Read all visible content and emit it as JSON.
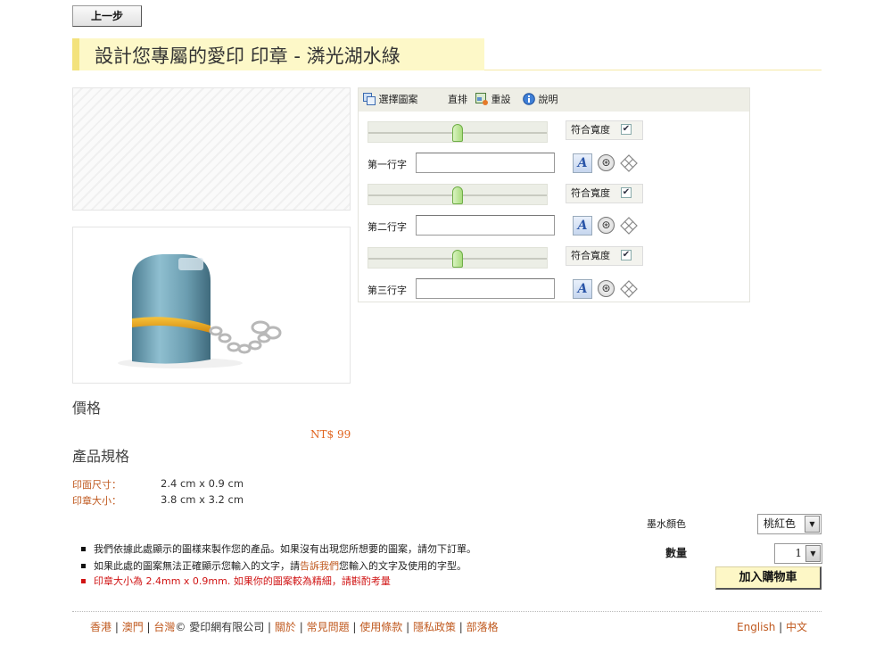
{
  "nav": {
    "back_label": "上一步"
  },
  "title": "設計您專屬的愛印 印章 - 潾光湖水綠",
  "toolbar": {
    "select_pattern": "選擇圖案",
    "vertical": "直排",
    "reset": "重設",
    "help": "說明"
  },
  "editor": {
    "fit_width_label": "符合寬度",
    "lines": [
      {
        "label": "第一行字",
        "value": "",
        "slider_level": 0.5,
        "fit_checked": true
      },
      {
        "label": "第二行字",
        "value": "",
        "slider_level": 0.5,
        "fit_checked": true
      },
      {
        "label": "第三行字",
        "value": "",
        "slider_level": 0.5,
        "fit_checked": true
      }
    ],
    "font_button_glyph": "A"
  },
  "price": {
    "heading": "價格",
    "value": "NT$ 99"
  },
  "specs": {
    "heading": "產品規格",
    "rows": [
      {
        "label": "印面尺寸：",
        "value": "2.4 cm x 0.9 cm"
      },
      {
        "label": "印章大小：",
        "value": "3.8 cm x 3.2 cm"
      }
    ]
  },
  "order": {
    "ink_label": "墨水顏色",
    "ink_value": "桃紅色",
    "qty_label": "數量",
    "qty_value": "1",
    "add_to_cart": "加入購物車"
  },
  "notes": [
    {
      "text": "我們依據此處顯示的圖樣來製作您的產品。如果沒有出現您所想要的圖案，請勿下訂單。"
    },
    {
      "pre": "如果此處的圖案無法正確顯示您輸入的文字，請",
      "link": "告訴我們",
      "post": "您輸入的文字及使用的字型。"
    },
    {
      "text": "印章大小為 2.4mm x 0.9mm. 如果你的圖案較為精細，請斟酌考量"
    }
  ],
  "footer": {
    "hk": "香港",
    "macau": "澳門",
    "taiwan": "台灣",
    "copyright": "© 愛印網有限公司",
    "about": "關於",
    "faq": "常見問題",
    "terms": "使用條款",
    "privacy": "隱私政策",
    "blog": "部落格",
    "english": "English",
    "chinese": "中文"
  },
  "colors": {
    "title_bg": "#fdf8c8",
    "accent_orange": "#c05a20",
    "price_orange": "#e0641e",
    "warning_red": "#d01414",
    "slider_green": "#a9dc7e"
  }
}
